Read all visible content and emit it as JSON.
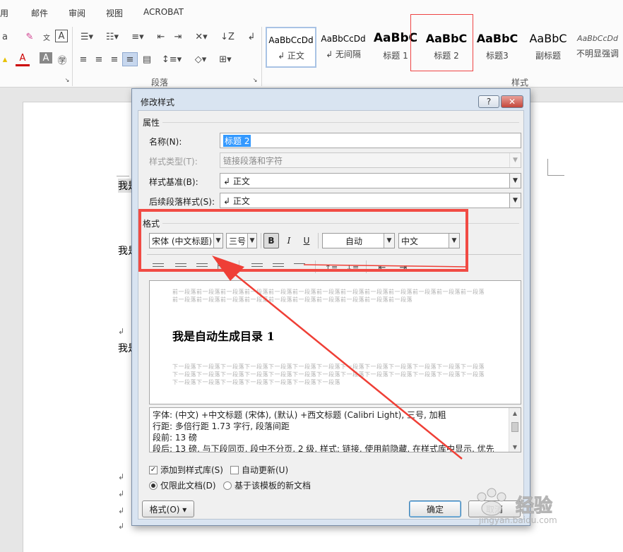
{
  "ribbon": {
    "tabs": [
      "用",
      "邮件",
      "审阅",
      "视图",
      "ACROBAT"
    ],
    "paragraph_group_label": "段落",
    "styles_group_label": "样式",
    "styles": [
      {
        "preview": "AaBbCcDd",
        "name": "↲ 正文"
      },
      {
        "preview": "AaBbCcDd",
        "name": "↲ 无间隔"
      },
      {
        "preview": "AaBbC",
        "name": "标题 1"
      },
      {
        "preview": "AaBbC",
        "name": "标题 2"
      },
      {
        "preview": "AaBbC",
        "name": "标题3"
      },
      {
        "preview": "AaBbC",
        "name": "副标题"
      },
      {
        "preview": "AaBbCcDd",
        "name": "不明显强调"
      }
    ]
  },
  "document": {
    "line1": "我是",
    "line2": "我是",
    "line3": "我是",
    "para_mark": "↲"
  },
  "dialog": {
    "title": "修改样式",
    "help_label": "?",
    "close_label": "✕",
    "properties_section": "属性",
    "name_label": "名称(N):",
    "name_value": "标题 2",
    "style_type_label": "样式类型(T):",
    "style_type_value": "链接段落和字符",
    "based_on_label": "样式基准(B):",
    "based_on_value": "↲ 正文",
    "following_label": "后续段落样式(S):",
    "following_value": "↲ 正文",
    "format_section": "格式",
    "font_value": "宋体 (中文标题)",
    "size_value": "三号",
    "bold_label": "B",
    "italic_label": "I",
    "underline_label": "U",
    "color_value": "自动",
    "language_value": "中文",
    "preview_before": "前一段落前一段落前一段落前一段落前一段落前一段落前一段落前一段落前一段落前一段落前一段落前一段落前一段落前一段落前一段落前一段落前一段落前一段落前一段落前一段落前一段落前一段落前一段落",
    "preview_heading": "我是自动生成目录 1",
    "preview_after": "下一段落下一段落下一段落下一段落下一段落下一段落下一段落下一段落下一段落下一段落下一段落下一段落下一段落下一段落下一段落下一段落下一段落下一段落下一段落下一段落下一段落下一段落下一段落下一段落下一段落下一段落下一段落下一段落下一段落下一段落下一段落下一段落下一段落",
    "description": [
      "字体: (中文) +中文标题 (宋体), (默认) +西文标题 (Calibri Light), 三号, 加粗",
      "    行距: 多倍行距 1.73 字行, 段落间距",
      "    段前: 13 磅",
      "    段后: 13 磅, 与下段同页, 段中不分页, 2 级, 样式: 链接, 使用前隐藏, 在样式库中显示, 优先"
    ],
    "add_to_gallery_label": "添加到样式库(S)",
    "add_to_gallery_checked": true,
    "auto_update_label": "自动更新(U)",
    "auto_update_checked": false,
    "only_this_doc_label": "仅限此文档(D)",
    "new_docs_label": "基于该模板的新文档",
    "format_button_label": "格式(O) ▾",
    "ok_label": "确定",
    "cancel_label": "取消"
  },
  "watermark": {
    "text": "经验",
    "sub": "jingyan.baidu.com"
  },
  "colors": {
    "annotation_red": "#f14b44",
    "selection_blue": "#3399ff"
  }
}
